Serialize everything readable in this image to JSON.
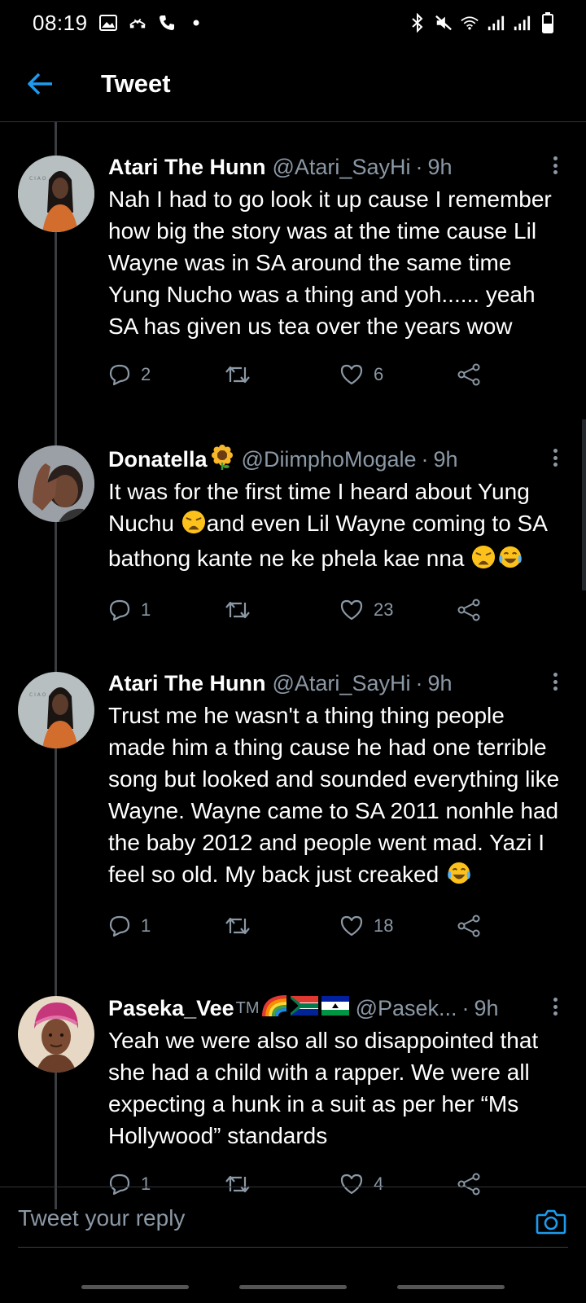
{
  "status_bar": {
    "time": "08:19"
  },
  "header": {
    "title": "Tweet"
  },
  "tweets": [
    {
      "name": "Atari The Hunn",
      "handle": "@Atari_SayHi",
      "time": "9h",
      "text": "Nah I had to go look it up cause I remember how big the story was at the time cause Lil Wayne was in SA around the same time Yung Nucho was a thing and yoh...... yeah SA has  given us tea over the years wow",
      "replies": "2",
      "retweets": "",
      "likes": "6"
    },
    {
      "name": "Donatella",
      "handle": "@DiimphoMogale",
      "time": "9h",
      "text_part1": "It was for the first time I heard about Yung Nuchu ",
      "text_part2": "and even Lil Wayne coming to SA bathong kante ne ke phela kae nna ",
      "replies": "1",
      "retweets": "",
      "likes": "23"
    },
    {
      "name": "Atari The Hunn",
      "handle": "@Atari_SayHi",
      "time": "9h",
      "text": "Trust me he wasn't a thing thing people made him a thing cause he had one terrible song but looked and sounded everything like Wayne. Wayne came to SA 2011 nonhle had the baby 2012 and people went mad. Yazi I feel so old. My back just creaked ",
      "replies": "1",
      "retweets": "",
      "likes": "18"
    },
    {
      "name": "Paseka_Vee",
      "name_suffix": "TM",
      "handle": "@Pasek...",
      "time": "9h",
      "text": "Yeah we were also all so disappointed that she had a child with a rapper. We were all expecting a hunk in a suit as per her “Ms Hollywood” standards",
      "replies": "1",
      "retweets": "",
      "likes": "4"
    }
  ],
  "reply": {
    "placeholder": "Tweet your reply"
  },
  "colors": {
    "accent": "#1d9bf0",
    "secondary_text": "#8b98a5",
    "background": "#000000"
  },
  "icons": [
    "back-arrow-icon",
    "reply-icon",
    "retweet-icon",
    "like-icon",
    "share-icon",
    "more-icon",
    "camera-icon"
  ]
}
